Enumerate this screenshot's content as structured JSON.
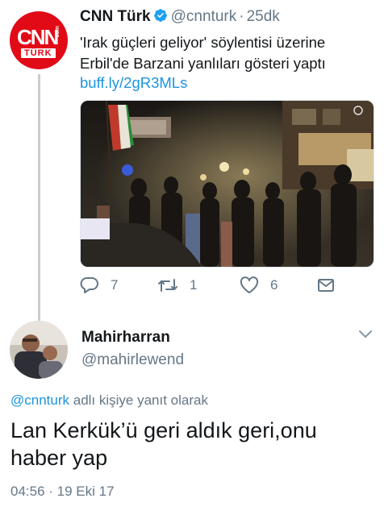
{
  "tweet1": {
    "avatar": {
      "logo_main": "CNN",
      "logo_sub": "TÜRK",
      "logo_com": "com"
    },
    "author_name": "CNN Türk",
    "handle": "@cnnturk",
    "separator": "·",
    "time": "25dk",
    "text": "'Irak güçleri geliyor' söylentisi üzerine Erbil'de Barzani yanlıları gösteri yaptı",
    "link": "buff.ly/2gR3MLs",
    "actions": {
      "reply_count": "7",
      "retweet_count": "1",
      "like_count": "6"
    }
  },
  "tweet2": {
    "author_name": "Mahirharran",
    "handle": "@mahirlewend",
    "reply_context_mention": "@cnnturk",
    "reply_context_suffix": " adlı kişiye yanıt olarak",
    "text": "Lan Kerkük’ü geri aldık geri,onu haber yap",
    "timestamp": "04:56 · 19 Eki 17"
  },
  "colors": {
    "link": "#1b95e0",
    "secondary": "#657786",
    "brand_red": "#e10a17",
    "verified": "#1da1f2"
  },
  "icons": [
    "verified-icon",
    "reply-icon",
    "retweet-icon",
    "like-icon",
    "share-icon",
    "chevron-down-icon"
  ]
}
